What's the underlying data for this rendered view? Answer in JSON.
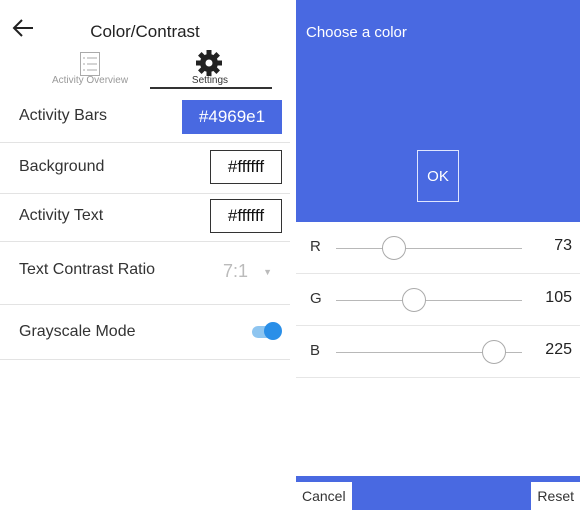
{
  "screen": {
    "title": "Color/Contrast",
    "tabs": [
      {
        "label": "Activity Overview",
        "icon": "list-icon"
      },
      {
        "label": "Settings",
        "icon": "gear-icon",
        "active": true
      }
    ],
    "rows": {
      "activity_bars": {
        "label": "Activity Bars",
        "value": "#4969e1"
      },
      "background": {
        "label": "Background",
        "value": "#ffffff"
      },
      "activity_text": {
        "label": "Activity Text",
        "value": "#ffffff"
      },
      "contrast": {
        "label": "Text Contrast Ratio",
        "value": "7:1"
      },
      "grayscale": {
        "label": "Grayscale Mode",
        "enabled": true
      }
    }
  },
  "dialog": {
    "title": "Choose a color",
    "ok_label": "OK",
    "sliders": [
      {
        "channel": "R",
        "value": "73"
      },
      {
        "channel": "G",
        "value": "105"
      },
      {
        "channel": "B",
        "value": "225"
      }
    ],
    "cancel_label": "Cancel",
    "reset_label": "Reset"
  },
  "colors": {
    "accent": "#4969e1",
    "toggle_on": "#2a8fe8"
  }
}
